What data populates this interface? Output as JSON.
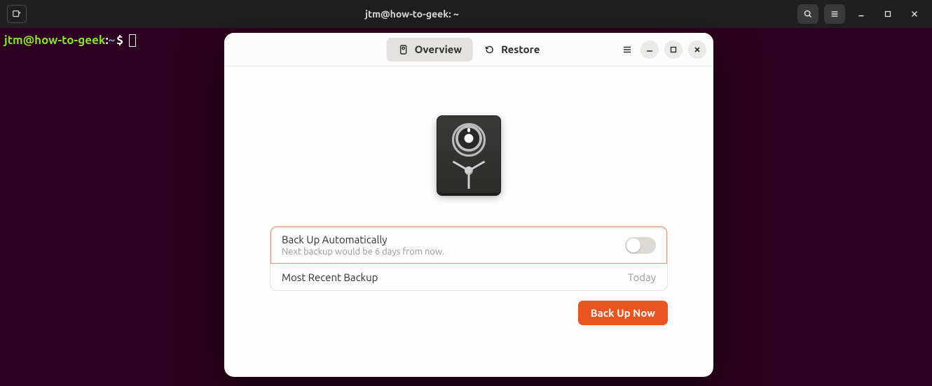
{
  "terminal": {
    "title": "jtm@how-to-geek: ~",
    "prompt_user": "jtm@how-to-geek",
    "prompt_sep": ":",
    "prompt_path": "~",
    "prompt_symbol": "$"
  },
  "backup": {
    "tabs": {
      "overview": "Overview",
      "restore": "Restore"
    },
    "auto": {
      "title": "Back Up Automatically",
      "subtitle": "Next backup would be 6 days from now.",
      "enabled": false
    },
    "recent": {
      "label": "Most Recent Backup",
      "value": "Today"
    },
    "action_button": "Back Up Now"
  }
}
